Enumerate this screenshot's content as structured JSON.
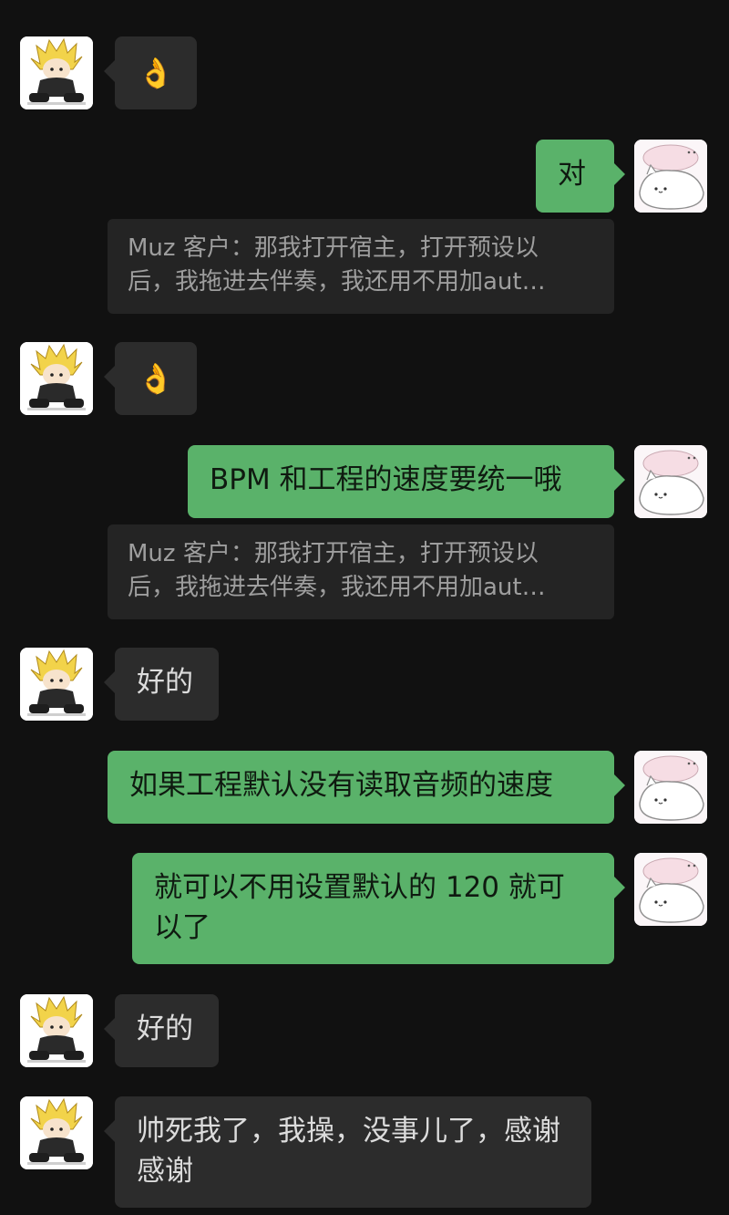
{
  "messages": [
    {
      "side": "in",
      "text": "👌"
    },
    {
      "side": "out",
      "text": "对",
      "quote_line1": "Muz 客户：那我打开宿主，打开预设以",
      "quote_line2": "后，我拖进去伴奏，我还用不用加aut…"
    },
    {
      "side": "in",
      "text": "👌"
    },
    {
      "side": "out",
      "text": "BPM 和工程的速度要统一哦",
      "quote_line1": "Muz 客户：那我打开宿主，打开预设以",
      "quote_line2": "后，我拖进去伴奏，我还用不用加aut…"
    },
    {
      "side": "in",
      "text": "好的"
    },
    {
      "side": "out",
      "text": "如果工程默认没有读取音频的速度"
    },
    {
      "side": "out",
      "text": "就可以不用设置默认的 120 就可以了"
    },
    {
      "side": "in",
      "text": "好的"
    },
    {
      "side": "in",
      "text": "帅死我了，我操，没事儿了，感谢感谢"
    }
  ],
  "avatars": {
    "self": "cartoon-spiky-hair-avatar",
    "other": "white-cat-sticker-avatar"
  }
}
